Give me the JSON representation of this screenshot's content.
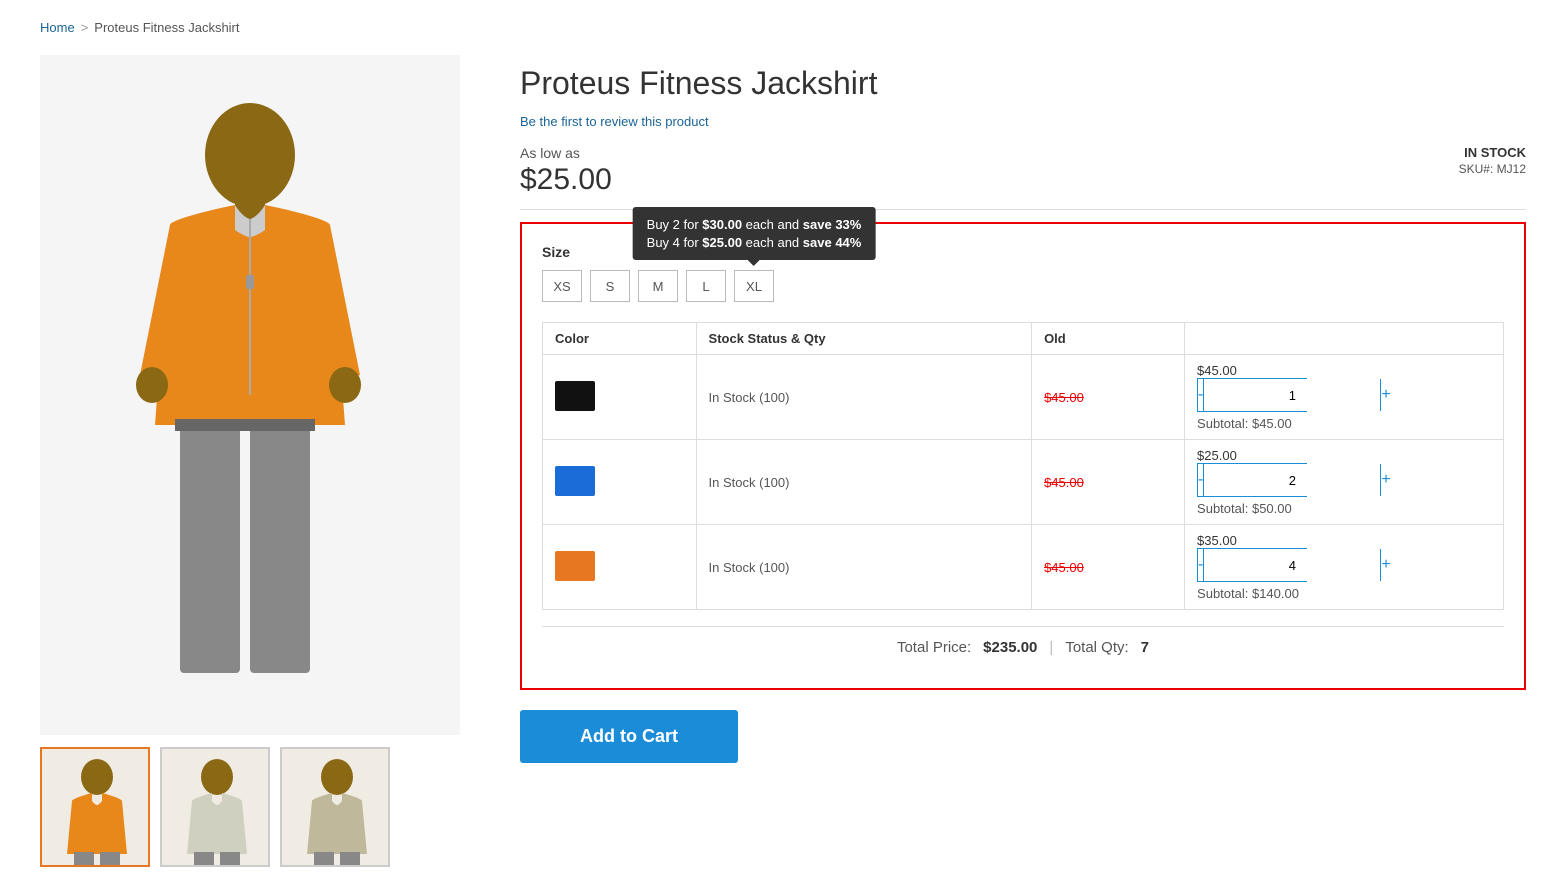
{
  "breadcrumb": {
    "home_label": "Home",
    "separator": ">",
    "current": "Proteus Fitness Jackshirt"
  },
  "product": {
    "title": "Proteus Fitness Jackshirt",
    "review_link": "Be the first to review this product",
    "as_low_as": "As low as",
    "price": "$25.00",
    "stock_status": "IN STOCK",
    "sku_label": "SKU#:",
    "sku_value": "MJ12"
  },
  "size": {
    "label": "Size",
    "options": [
      "XS",
      "S",
      "M",
      "L",
      "XL"
    ]
  },
  "tooltip": {
    "line1_prefix": "Buy 2 for ",
    "line1_price": "$30.00",
    "line1_suffix": " each and ",
    "line1_save": "save 33%",
    "line2_prefix": "Buy 4 for ",
    "line2_price": "$25.00",
    "line2_suffix": " each and ",
    "line2_save": "save 44%"
  },
  "table": {
    "headers": [
      "Color",
      "Stock Status & Qty",
      "Old",
      ""
    ],
    "rows": [
      {
        "color": "black",
        "color_hex": "#111111",
        "stock": "In Stock (100)",
        "old_price": "$45.00",
        "new_price": "$45.00",
        "qty": 1,
        "subtotal": "$45.00"
      },
      {
        "color": "blue",
        "color_hex": "#1a6cd8",
        "stock": "In Stock (100)",
        "old_price": "$45.00",
        "new_price": "$25.00",
        "qty": 2,
        "subtotal": "$50.00"
      },
      {
        "color": "orange",
        "color_hex": "#e87722",
        "stock": "In Stock (100)",
        "old_price": "$45.00",
        "new_price": "$35.00",
        "qty": 4,
        "subtotal": "$140.00"
      }
    ]
  },
  "totals": {
    "total_price_label": "Total Price:",
    "total_price_value": "$235.00",
    "separator": "|",
    "total_qty_label": "Total Qty:",
    "total_qty_value": "7"
  },
  "add_to_cart": {
    "label": "Add to Cart"
  },
  "qty_controls": {
    "minus": "-",
    "plus": "+"
  }
}
